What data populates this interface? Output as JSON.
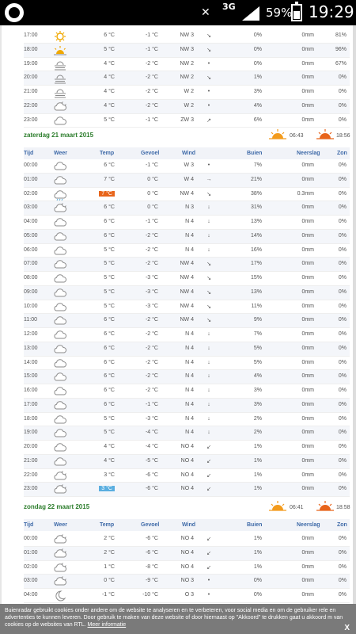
{
  "statusbar": {
    "network": "3G",
    "battery": "59%",
    "time": "19:29"
  },
  "headers": {
    "tijd": "Tijd",
    "weer": "Weer",
    "temp": "Temp",
    "gevoel": "Gevoel",
    "wind": "Wind",
    "buien": "Buien",
    "neerslag": "Neerslag",
    "zon": "Zon"
  },
  "section1": {
    "rows": [
      {
        "t": "17:00",
        "w": "sun",
        "temp": "6 °C",
        "feel": "-1 °C",
        "wind": "NW 3",
        "dir": "↘",
        "rain": "0%",
        "mm": "0mm",
        "sun": "81%"
      },
      {
        "t": "18:00",
        "w": "sunset",
        "temp": "5 °C",
        "feel": "-1 °C",
        "wind": "NW 3",
        "dir": "↘",
        "rain": "0%",
        "mm": "0mm",
        "sun": "96%"
      },
      {
        "t": "19:00",
        "w": "fog",
        "temp": "4 °C",
        "feel": "-2 °C",
        "wind": "NW 2",
        "dir": "•",
        "rain": "0%",
        "mm": "0mm",
        "sun": "67%"
      },
      {
        "t": "20:00",
        "w": "fog",
        "temp": "4 °C",
        "feel": "-2 °C",
        "wind": "NW 2",
        "dir": "↘",
        "rain": "1%",
        "mm": "0mm",
        "sun": "0%"
      },
      {
        "t": "21:00",
        "w": "fog",
        "temp": "4 °C",
        "feel": "-2 °C",
        "wind": "W 2",
        "dir": "•",
        "rain": "3%",
        "mm": "0mm",
        "sun": "0%"
      },
      {
        "t": "22:00",
        "w": "cloudmoon",
        "temp": "4 °C",
        "feel": "-2 °C",
        "wind": "W 2",
        "dir": "•",
        "rain": "4%",
        "mm": "0mm",
        "sun": "0%"
      },
      {
        "t": "23:00",
        "w": "cloud",
        "temp": "5 °C",
        "feel": "-1 °C",
        "wind": "ZW 3",
        "dir": "↗",
        "rain": "6%",
        "mm": "0mm",
        "sun": "0%"
      }
    ]
  },
  "day2": {
    "title": "zaterdag 21 maart 2015",
    "sunrise": "06:43",
    "sunset": "18:56",
    "rows": [
      {
        "t": "00:00",
        "w": "cloud",
        "temp": "6 °C",
        "feel": "-1 °C",
        "wind": "W 3",
        "dir": "•",
        "rain": "7%",
        "mm": "0mm",
        "sun": "0%"
      },
      {
        "t": "01:00",
        "w": "cloud",
        "temp": "7 °C",
        "feel": "0 °C",
        "wind": "W 4",
        "dir": "→",
        "rain": "21%",
        "mm": "0mm",
        "sun": "0%"
      },
      {
        "t": "02:00",
        "w": "rain",
        "temp": "7 °C",
        "hi": true,
        "feel": "0 °C",
        "wind": "NW 4",
        "dir": "↘",
        "rain": "38%",
        "mm": "0.3mm",
        "sun": "0%"
      },
      {
        "t": "03:00",
        "w": "cloudmoon",
        "temp": "6 °C",
        "feel": "0 °C",
        "wind": "N 3",
        "dir": "↓",
        "rain": "31%",
        "mm": "0mm",
        "sun": "0%"
      },
      {
        "t": "04:00",
        "w": "cloud",
        "temp": "6 °C",
        "feel": "-1 °C",
        "wind": "N 4",
        "dir": "↓",
        "rain": "13%",
        "mm": "0mm",
        "sun": "0%"
      },
      {
        "t": "05:00",
        "w": "cloud",
        "temp": "6 °C",
        "feel": "-2 °C",
        "wind": "N 4",
        "dir": "↓",
        "rain": "14%",
        "mm": "0mm",
        "sun": "0%"
      },
      {
        "t": "06:00",
        "w": "cloud",
        "temp": "5 °C",
        "feel": "-2 °C",
        "wind": "N 4",
        "dir": "↓",
        "rain": "16%",
        "mm": "0mm",
        "sun": "0%"
      },
      {
        "t": "07:00",
        "w": "cloud",
        "temp": "5 °C",
        "feel": "-2 °C",
        "wind": "NW 4",
        "dir": "↘",
        "rain": "17%",
        "mm": "0mm",
        "sun": "0%"
      },
      {
        "t": "08:00",
        "w": "cloud",
        "temp": "5 °C",
        "feel": "-3 °C",
        "wind": "NW 4",
        "dir": "↘",
        "rain": "15%",
        "mm": "0mm",
        "sun": "0%"
      },
      {
        "t": "09:00",
        "w": "cloud",
        "temp": "5 °C",
        "feel": "-3 °C",
        "wind": "NW 4",
        "dir": "↘",
        "rain": "13%",
        "mm": "0mm",
        "sun": "0%"
      },
      {
        "t": "10:00",
        "w": "cloud",
        "temp": "5 °C",
        "feel": "-3 °C",
        "wind": "NW 4",
        "dir": "↘",
        "rain": "11%",
        "mm": "0mm",
        "sun": "0%"
      },
      {
        "t": "11:00",
        "w": "cloud",
        "temp": "6 °C",
        "feel": "-2 °C",
        "wind": "NW 4",
        "dir": "↘",
        "rain": "9%",
        "mm": "0mm",
        "sun": "0%"
      },
      {
        "t": "12:00",
        "w": "cloud",
        "temp": "6 °C",
        "feel": "-2 °C",
        "wind": "N 4",
        "dir": "↓",
        "rain": "7%",
        "mm": "0mm",
        "sun": "0%"
      },
      {
        "t": "13:00",
        "w": "cloud",
        "temp": "6 °C",
        "feel": "-2 °C",
        "wind": "N 4",
        "dir": "↓",
        "rain": "5%",
        "mm": "0mm",
        "sun": "0%"
      },
      {
        "t": "14:00",
        "w": "cloud",
        "temp": "6 °C",
        "feel": "-2 °C",
        "wind": "N 4",
        "dir": "↓",
        "rain": "5%",
        "mm": "0mm",
        "sun": "0%"
      },
      {
        "t": "15:00",
        "w": "cloud",
        "temp": "6 °C",
        "feel": "-2 °C",
        "wind": "N 4",
        "dir": "↓",
        "rain": "4%",
        "mm": "0mm",
        "sun": "0%"
      },
      {
        "t": "16:00",
        "w": "cloud",
        "temp": "6 °C",
        "feel": "-2 °C",
        "wind": "N 4",
        "dir": "↓",
        "rain": "3%",
        "mm": "0mm",
        "sun": "0%"
      },
      {
        "t": "17:00",
        "w": "cloud",
        "temp": "6 °C",
        "feel": "-1 °C",
        "wind": "N 4",
        "dir": "↓",
        "rain": "3%",
        "mm": "0mm",
        "sun": "0%"
      },
      {
        "t": "18:00",
        "w": "cloud",
        "temp": "5 °C",
        "feel": "-3 °C",
        "wind": "N 4",
        "dir": "↓",
        "rain": "2%",
        "mm": "0mm",
        "sun": "0%"
      },
      {
        "t": "19:00",
        "w": "cloud",
        "temp": "5 °C",
        "feel": "-4 °C",
        "wind": "N 4",
        "dir": "↓",
        "rain": "2%",
        "mm": "0mm",
        "sun": "0%"
      },
      {
        "t": "20:00",
        "w": "cloud",
        "temp": "4 °C",
        "feel": "-4 °C",
        "wind": "NO 4",
        "dir": "↙",
        "rain": "1%",
        "mm": "0mm",
        "sun": "0%"
      },
      {
        "t": "21:00",
        "w": "cloud",
        "temp": "4 °C",
        "feel": "-5 °C",
        "wind": "NO 4",
        "dir": "↙",
        "rain": "1%",
        "mm": "0mm",
        "sun": "0%"
      },
      {
        "t": "22:00",
        "w": "cloudmoon",
        "temp": "3 °C",
        "feel": "-6 °C",
        "wind": "NO 4",
        "dir": "↙",
        "rain": "1%",
        "mm": "0mm",
        "sun": "0%"
      },
      {
        "t": "23:00",
        "w": "cloudmoon",
        "temp": "3 °C",
        "lo": true,
        "feel": "-6 °C",
        "wind": "NO 4",
        "dir": "↙",
        "rain": "1%",
        "mm": "0mm",
        "sun": "0%"
      }
    ]
  },
  "day3": {
    "title": "zondag 22 maart 2015",
    "sunrise": "06:41",
    "sunset": "18:58",
    "rows": [
      {
        "t": "00:00",
        "w": "cloudmoon",
        "temp": "2 °C",
        "feel": "-6 °C",
        "wind": "NO 4",
        "dir": "↙",
        "rain": "1%",
        "mm": "0mm",
        "sun": "0%"
      },
      {
        "t": "01:00",
        "w": "cloudmoon",
        "temp": "2 °C",
        "feel": "-6 °C",
        "wind": "NO 4",
        "dir": "↙",
        "rain": "1%",
        "mm": "0mm",
        "sun": "0%"
      },
      {
        "t": "02:00",
        "w": "cloudmoon",
        "temp": "1 °C",
        "feel": "-8 °C",
        "wind": "NO 4",
        "dir": "↙",
        "rain": "1%",
        "mm": "0mm",
        "sun": "0%"
      },
      {
        "t": "03:00",
        "w": "cloudmoon",
        "temp": "0 °C",
        "feel": "-9 °C",
        "wind": "NO 3",
        "dir": "•",
        "rain": "0%",
        "mm": "0mm",
        "sun": "0%"
      },
      {
        "t": "04:00",
        "w": "moon",
        "temp": "-1 °C",
        "feel": "-10 °C",
        "wind": "O 3",
        "dir": "•",
        "rain": "0%",
        "mm": "0mm",
        "sun": "0%"
      }
    ]
  },
  "cookie": {
    "text": "Buienradar gebruikt cookies onder andere om de website te analyseren en te verbeteren, voor social media en om de gebruiker rele en advertenties te kunnen leveren. Door gebruik te maken van deze website of door hiernaast op \"Akkoord\" te drukken gaat u akkoord m van cookies op de websites van RTL.",
    "link": "Meer informatie",
    "close": "X"
  }
}
